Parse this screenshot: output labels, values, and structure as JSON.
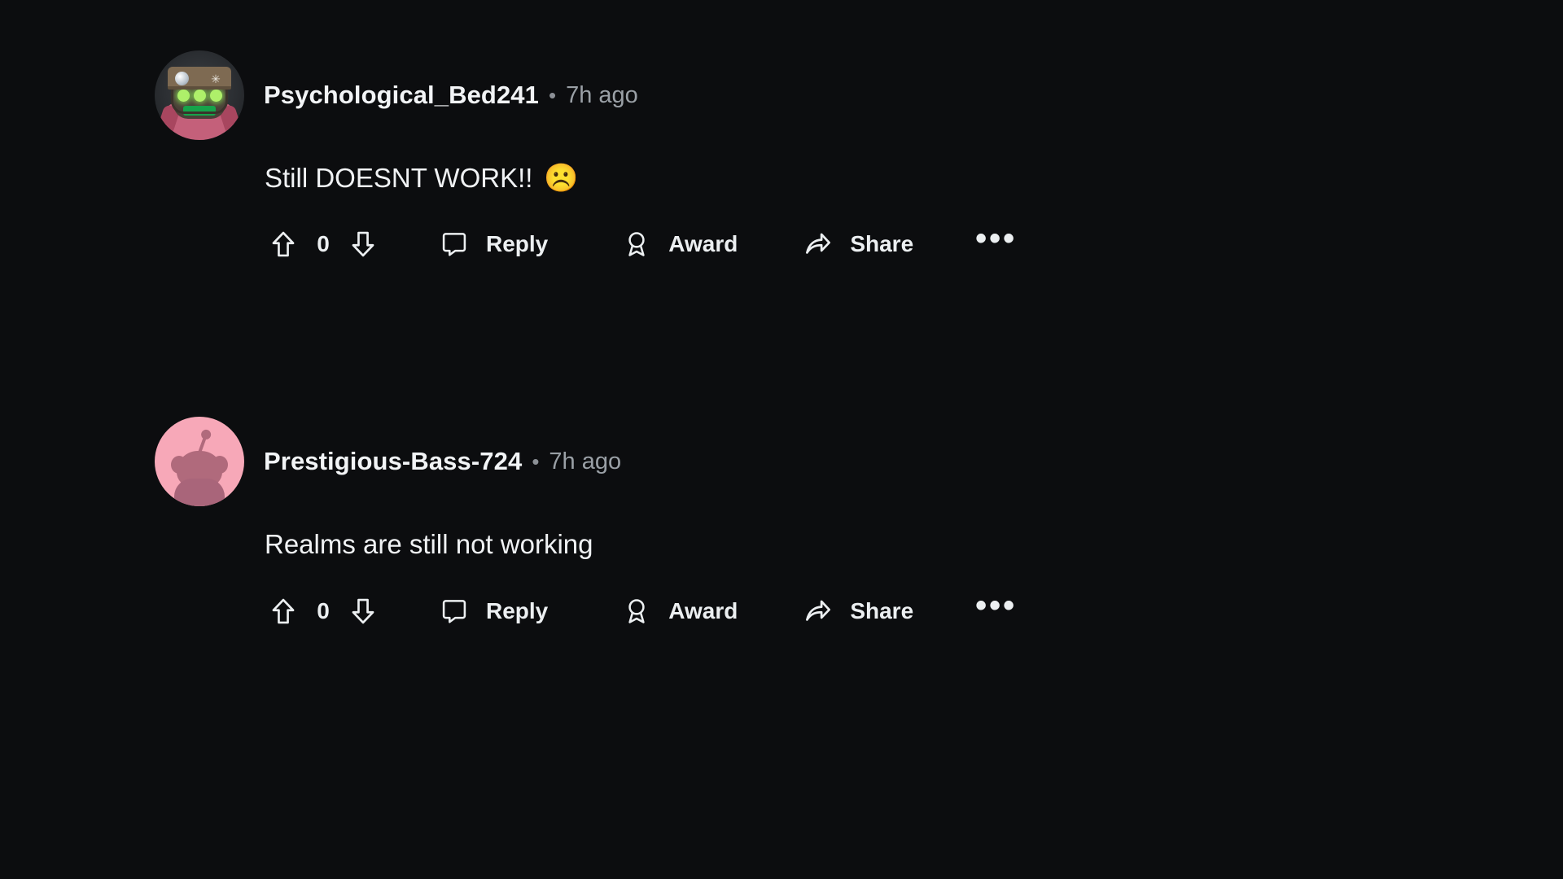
{
  "theme": {
    "background": "#0c0d0f",
    "text_primary": "#f0f2f4",
    "text_muted": "#9aa0a6",
    "snoo_pink": "#f7a8b8"
  },
  "comments": [
    {
      "avatar_type": "miner-avatar",
      "username": "Psychological_Bed241",
      "separator": "•",
      "timestamp": "7h ago",
      "body": "Still DOESNT WORK!!",
      "emoji": "☹️",
      "actions": {
        "upvote_icon": "upvote-arrow-icon",
        "vote_count": "0",
        "downvote_icon": "downvote-arrow-icon",
        "reply_label": "Reply",
        "award_label": "Award",
        "share_label": "Share",
        "overflow_label": "•••"
      }
    },
    {
      "avatar_type": "snoo-avatar",
      "username": "Prestigious-Bass-724",
      "separator": "•",
      "timestamp": "7h ago",
      "body": "Realms are still not working",
      "emoji": "",
      "actions": {
        "upvote_icon": "upvote-arrow-icon",
        "vote_count": "0",
        "downvote_icon": "downvote-arrow-icon",
        "reply_label": "Reply",
        "award_label": "Award",
        "share_label": "Share",
        "overflow_label": "•••"
      }
    }
  ]
}
